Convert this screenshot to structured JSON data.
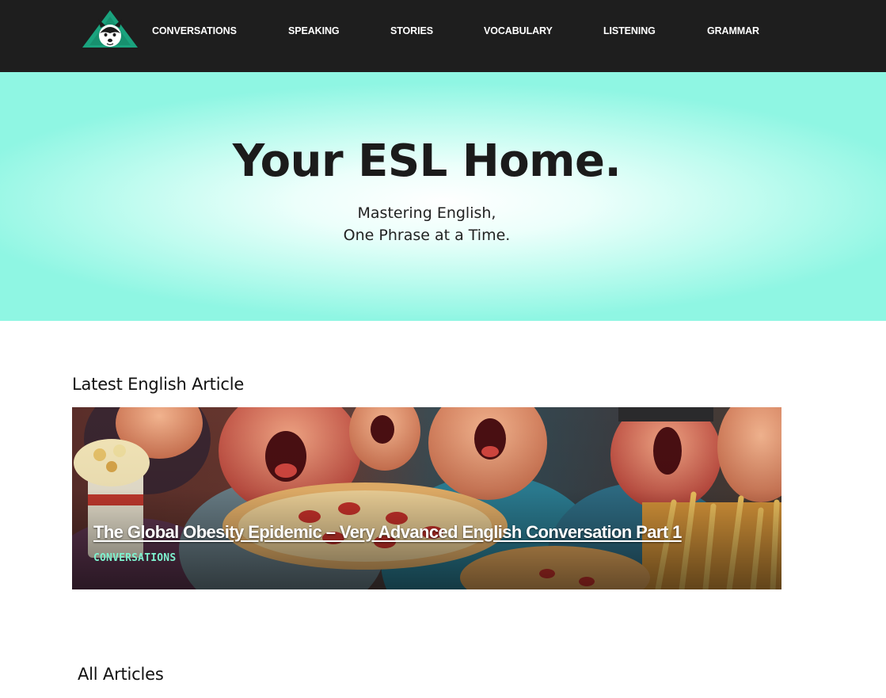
{
  "nav": {
    "logo_alt": "ESL husky logo",
    "items": [
      {
        "label": "CONVERSATIONS"
      },
      {
        "label": "SPEAKING"
      },
      {
        "label": "STORIES"
      },
      {
        "label": "VOCABULARY"
      },
      {
        "label": "LISTENING"
      },
      {
        "label": "GRAMMAR"
      }
    ]
  },
  "hero": {
    "title": "Your ESL Home.",
    "subtitle_line1": "Mastering English,",
    "subtitle_line2": "One Phrase at a Time."
  },
  "latest": {
    "heading": "Latest English Article",
    "article": {
      "title": "The Global Obesity Epidemic – Very Advanced English Conversation Part 1",
      "category": "CONVERSATIONS"
    }
  },
  "all_articles": {
    "heading": "All Articles"
  },
  "colors": {
    "nav_bg": "#1e1e1e",
    "hero_accent": "#8ff6e3",
    "category_accent": "#7ef2cf",
    "logo_green": "#1aa37e"
  }
}
